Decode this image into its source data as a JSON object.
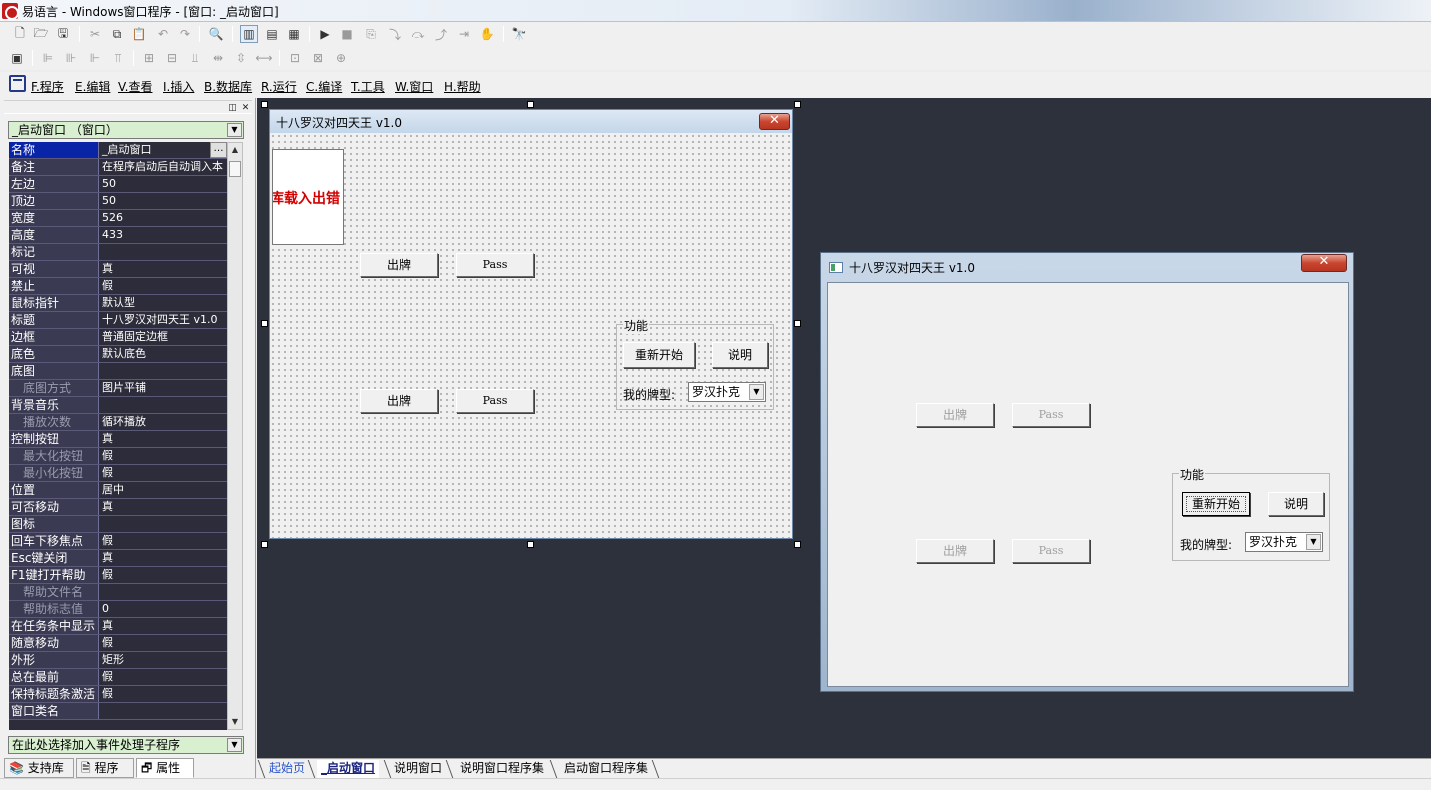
{
  "window": {
    "title": "易语言 - Windows窗口程序 - [窗口: _启动窗口]"
  },
  "toolbar": {
    "row1_icons": [
      "new-file-icon",
      "open-folder-icon",
      "save-icon",
      "cut-icon",
      "copy-icon",
      "paste-icon",
      "undo-icon",
      "redo-icon",
      "find-icon",
      "layout-left-icon",
      "layout-top-icon",
      "layout-split-icon",
      "run-icon",
      "stop-icon",
      "step-icon",
      "step-into-icon",
      "step-over-icon",
      "step-out-icon",
      "run-to-cursor-icon",
      "hand-icon",
      "debug-find-icon"
    ],
    "row2_icons": [
      "form-icon",
      "align-left-icon",
      "align-center-h-icon",
      "align-right-icon",
      "align-top-icon",
      "align-middle-icon",
      "align-bottom-icon",
      "center-h-icon",
      "same-width-icon",
      "same-height-icon",
      "space-h-icon",
      "space-v-icon",
      "same-size-icon"
    ]
  },
  "menu": {
    "items": [
      "F.程序",
      "E.编辑",
      "V.查看",
      "I.插入",
      "B.数据库",
      "R.运行",
      "C.编译",
      "T.工具",
      "W.窗口",
      "H.帮助"
    ]
  },
  "left_panel": {
    "object_combo": "_启动窗口 （窗口）",
    "event_combo": "在此处选择加入事件处理子程序",
    "properties": [
      {
        "name": "名称",
        "value": "_启动窗口",
        "selected": true
      },
      {
        "name": "备注",
        "value": "在程序启动后自动调入本"
      },
      {
        "name": "左边",
        "value": "50"
      },
      {
        "name": "顶边",
        "value": "50"
      },
      {
        "name": "宽度",
        "value": "526"
      },
      {
        "name": "高度",
        "value": "433"
      },
      {
        "name": "标记",
        "value": ""
      },
      {
        "name": "可视",
        "value": "真"
      },
      {
        "name": "禁止",
        "value": "假"
      },
      {
        "name": "鼠标指针",
        "value": "默认型"
      },
      {
        "name": "标题",
        "value": "十八罗汉对四天王 v1.0"
      },
      {
        "name": "边框",
        "value": "普通固定边框"
      },
      {
        "name": "底色",
        "value": "默认底色"
      },
      {
        "name": "底图",
        "value": ""
      },
      {
        "name": "底图方式",
        "value": "图片平铺",
        "sub": true
      },
      {
        "name": "背景音乐",
        "value": ""
      },
      {
        "name": "播放次数",
        "value": "循环播放",
        "sub": true
      },
      {
        "name": "控制按钮",
        "value": "真"
      },
      {
        "name": "最大化按钮",
        "value": "假",
        "sub": true
      },
      {
        "name": "最小化按钮",
        "value": "假",
        "sub": true
      },
      {
        "name": "位置",
        "value": "居中"
      },
      {
        "name": "可否移动",
        "value": "真"
      },
      {
        "name": "图标",
        "value": ""
      },
      {
        "name": "回车下移焦点",
        "value": "假"
      },
      {
        "name": "Esc键关闭",
        "value": "真"
      },
      {
        "name": "F1键打开帮助",
        "value": "假"
      },
      {
        "name": "帮助文件名",
        "value": "",
        "sub": true
      },
      {
        "name": "帮助标志值",
        "value": "0",
        "sub": true
      },
      {
        "name": "在任务条中显示",
        "value": "真"
      },
      {
        "name": "随意移动",
        "value": "假"
      },
      {
        "name": "外形",
        "value": "矩形"
      },
      {
        "name": "总在最前",
        "value": "假"
      },
      {
        "name": "保持标题条激活",
        "value": "假"
      },
      {
        "name": "窗口类名",
        "value": ""
      }
    ],
    "tabs": [
      "支持库",
      "程序",
      "属性"
    ]
  },
  "design_form": {
    "title": "十八罗汉对四天王 v1.0",
    "image_text": "库载入出错",
    "play_button": "出牌",
    "pass_button": "Pass",
    "group_title": "功能",
    "restart_button": "重新开始",
    "help_button": "说明",
    "card_type_label": "我的牌型:",
    "card_type_value": "罗汉扑克"
  },
  "preview_form": {
    "title": "十八罗汉对四天王 v1.0",
    "play_button": "出牌",
    "pass_button": "Pass",
    "group_title": "功能",
    "restart_button": "重新开始",
    "help_button": "说明",
    "card_type_label": "我的牌型:",
    "card_type_value": "罗汉扑克"
  },
  "bottom_tabs": [
    "起始页",
    "_启动窗口",
    "说明窗口",
    "说明窗口程序集",
    "启动窗口程序集"
  ],
  "colors": {
    "designer_background": "#2d313c",
    "property_grid_background": "#2c2c3a",
    "selected_property": "#0a24a8",
    "error_text": "#d40000"
  }
}
